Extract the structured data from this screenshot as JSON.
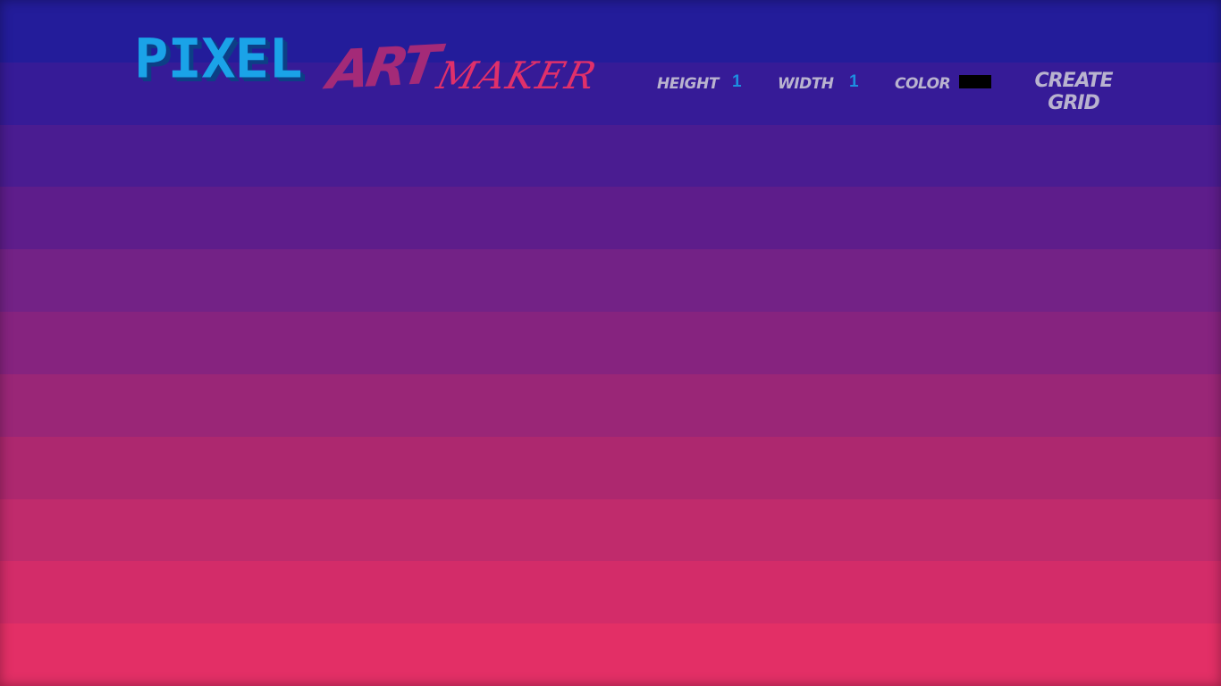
{
  "logo": {
    "word1": "PIXEL",
    "word2": "ART",
    "word3": "MAKER"
  },
  "controls": {
    "height_label": "HEIGHT",
    "height_value": "1",
    "width_label": "WIDTH",
    "width_value": "1",
    "color_label": "COLOR",
    "color_value": "#000000",
    "create_label": "CREATE GRID"
  },
  "colors": {
    "accent_blue": "#1aa3e8",
    "accent_purple": "#a42a78",
    "accent_pink": "#e0306a",
    "label_gray": "#b9b3cf",
    "background_top": "#231c9a",
    "background_bottom": "#e32f66"
  }
}
